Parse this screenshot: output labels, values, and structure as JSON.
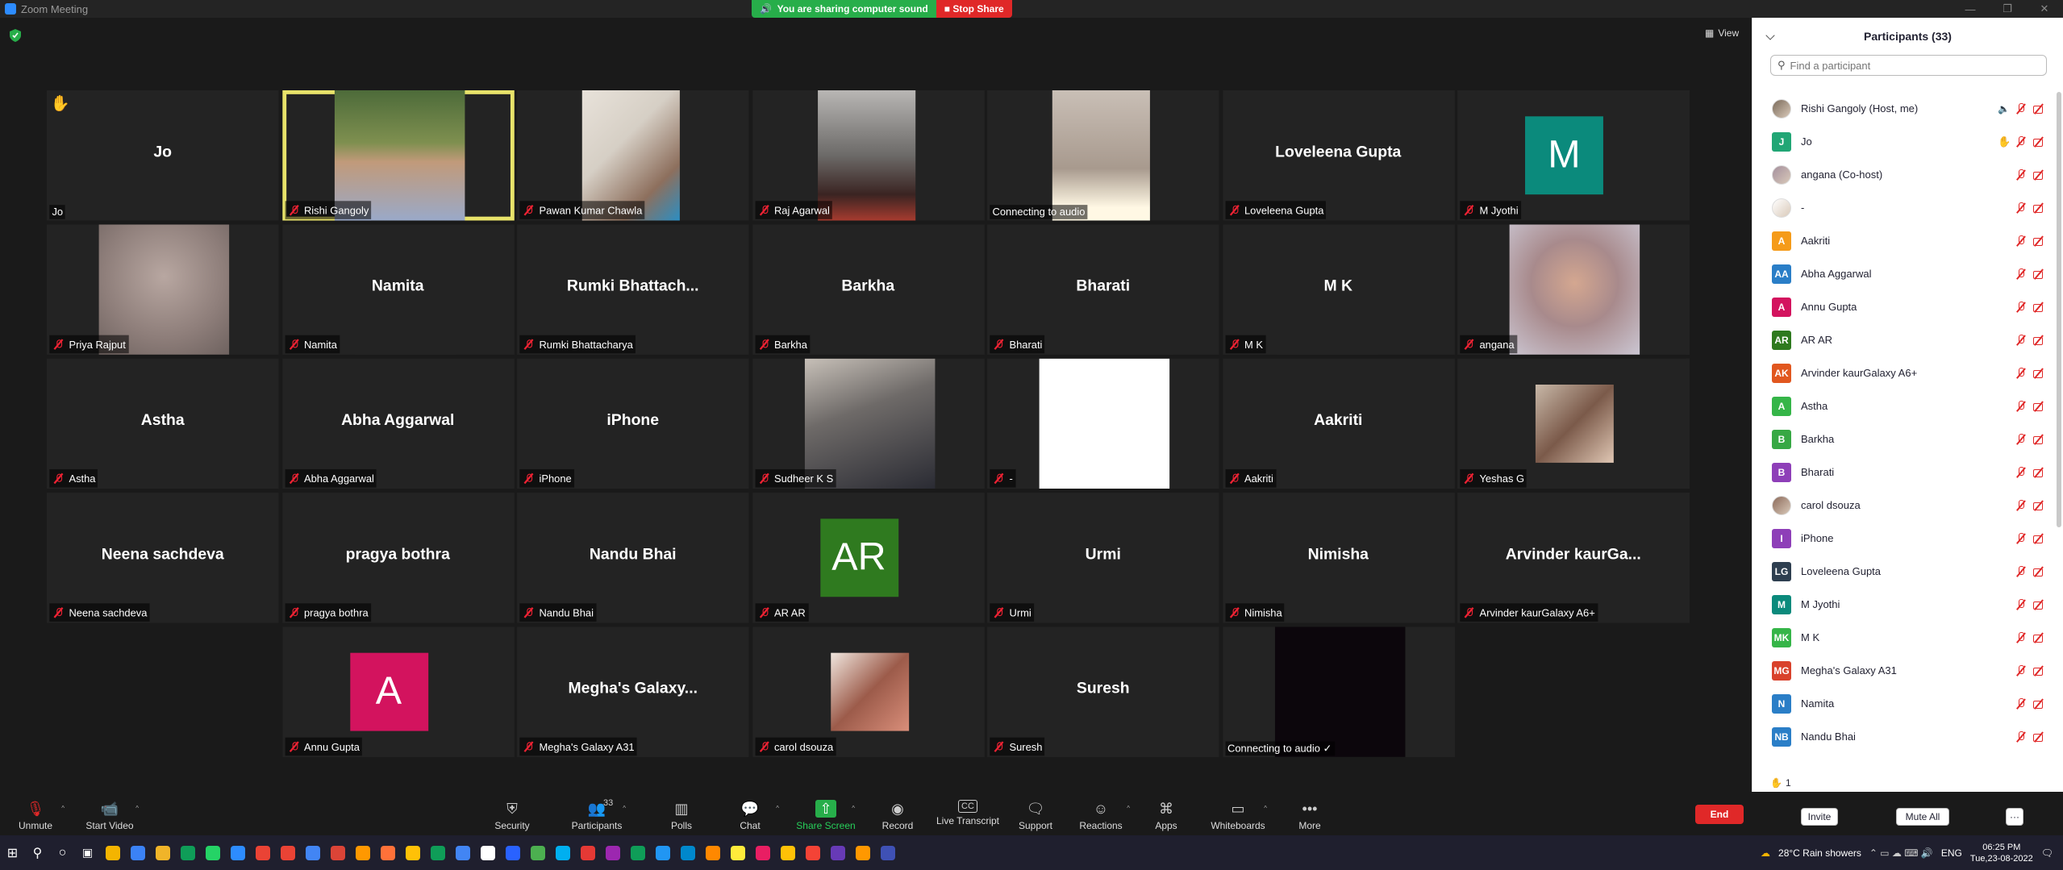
{
  "window": {
    "title": "Zoom Meeting"
  },
  "share_banner": {
    "sound_text": "You are sharing computer sound",
    "stop_label": "Stop Share"
  },
  "view_label": "View",
  "tiles": [
    {
      "big": "Jo",
      "label": "Jo",
      "muted": false,
      "hand": true
    },
    {
      "big": "",
      "label": "Rishi Gangoly",
      "muted": true,
      "photo": "rishi",
      "active": true
    },
    {
      "big": "",
      "label": "Pawan Kumar Chawla",
      "muted": true,
      "photo": "pawan"
    },
    {
      "big": "",
      "label": "Raj Agarwal",
      "muted": true,
      "photo": "raj"
    },
    {
      "big": "",
      "label": "Connecting to audio",
      "muted": false,
      "photo": "ceiling"
    },
    {
      "big": "Loveleena Gupta",
      "label": "Loveleena Gupta",
      "muted": true
    },
    {
      "big": "",
      "label": "M Jyothi",
      "muted": true,
      "avatar": "M",
      "avatar_color": "#0b8a7c"
    },
    {
      "big": "",
      "label": "Priya Rajput",
      "muted": true,
      "photo": "blur"
    },
    {
      "big": "Namita",
      "label": "Namita",
      "muted": true
    },
    {
      "big": "Rumki  Bhattach...",
      "label": "Rumki Bhattacharya",
      "muted": true
    },
    {
      "big": "Barkha",
      "label": "Barkha",
      "muted": true
    },
    {
      "big": "Bharati",
      "label": "Bharati",
      "muted": true
    },
    {
      "big": "M K",
      "label": "M K",
      "muted": true
    },
    {
      "big": "",
      "label": "angana",
      "muted": true,
      "photo": "angana"
    },
    {
      "big": "Astha",
      "label": "Astha",
      "muted": true
    },
    {
      "big": "Abha Aggarwal",
      "label": "Abha Aggarwal",
      "muted": true
    },
    {
      "big": "iPhone",
      "label": "iPhone",
      "muted": true
    },
    {
      "big": "",
      "label": "Sudheer K S",
      "muted": true,
      "photo": "sudheer"
    },
    {
      "big": "",
      "label": "-",
      "muted": true,
      "photo": "drawing"
    },
    {
      "big": "Aakriti",
      "label": "Aakriti",
      "muted": true
    },
    {
      "big": "",
      "label": "Yeshas G",
      "muted": true,
      "photo": "yeshas"
    },
    {
      "big": "Neena sachdeva",
      "label": "Neena sachdeva",
      "muted": true
    },
    {
      "big": "pragya bothra",
      "label": "pragya bothra",
      "muted": true
    },
    {
      "big": "Nandu Bhai",
      "label": "Nandu Bhai",
      "muted": true
    },
    {
      "big": "",
      "label": "AR AR",
      "muted": true,
      "avatar": "AR",
      "avatar_color": "#2f7a1f"
    },
    {
      "big": "Urmi",
      "label": "Urmi",
      "muted": true
    },
    {
      "big": "Nimisha",
      "label": "Nimisha",
      "muted": true
    },
    {
      "big": "Arvinder  kaurGa...",
      "label": "Arvinder kaurGalaxy A6+",
      "muted": true
    },
    {
      "big": "",
      "label": "Annu Gupta",
      "muted": true,
      "avatar": "A",
      "avatar_color": "#d3135e"
    },
    {
      "big": "Megha's  Galaxy...",
      "label": "Megha's Galaxy A31",
      "muted": true
    },
    {
      "big": "",
      "label": "carol dsouza",
      "muted": true,
      "photo": "carol"
    },
    {
      "big": "Suresh",
      "label": "Suresh",
      "muted": true
    },
    {
      "big": "",
      "label": "Connecting to audio ✓",
      "muted": false,
      "photo": "dark"
    }
  ],
  "participants_panel": {
    "title": "Participants (33)",
    "search_placeholder": "Find a participant",
    "participants": [
      {
        "name": "Rishi Gangoly (Host, me)",
        "initials": "",
        "color": "#7a6a5a",
        "photo": true,
        "speaking": true
      },
      {
        "name": "Jo",
        "initials": "J",
        "color": "#21a675",
        "hand": true
      },
      {
        "name": "angana (Co-host)",
        "initials": "",
        "color": "#a48f9d",
        "photo": true
      },
      {
        "name": "-",
        "initials": "",
        "color": "#ffffff",
        "photo": true
      },
      {
        "name": "Aakriti",
        "initials": "A",
        "color": "#f59b1a"
      },
      {
        "name": "Abha Aggarwal",
        "initials": "AA",
        "color": "#2a7ec7"
      },
      {
        "name": "Annu Gupta",
        "initials": "A",
        "color": "#d3135e"
      },
      {
        "name": "AR AR",
        "initials": "AR",
        "color": "#2f7a1f"
      },
      {
        "name": "Arvinder kaurGalaxy A6+",
        "initials": "AK",
        "color": "#e1571f"
      },
      {
        "name": "Astha",
        "initials": "A",
        "color": "#35b548"
      },
      {
        "name": "Barkha",
        "initials": "B",
        "color": "#37a844"
      },
      {
        "name": "Bharati",
        "initials": "B",
        "color": "#8e3fb8"
      },
      {
        "name": "carol dsouza",
        "initials": "",
        "color": "#8c6a5a",
        "photo": true
      },
      {
        "name": "iPhone",
        "initials": "I",
        "color": "#8e3fb8"
      },
      {
        "name": "Loveleena Gupta",
        "initials": "LG",
        "color": "#2e3f50"
      },
      {
        "name": "M Jyothi",
        "initials": "M",
        "color": "#0b8a7c"
      },
      {
        "name": "M K",
        "initials": "MK",
        "color": "#35b548"
      },
      {
        "name": "Megha's Galaxy A31",
        "initials": "MG",
        "color": "#d9422c"
      },
      {
        "name": "Namita",
        "initials": "N",
        "color": "#2a7ec7"
      },
      {
        "name": "Nandu Bhai",
        "initials": "NB",
        "color": "#2a7ec7"
      }
    ],
    "raised_count": "1",
    "invite_label": "Invite",
    "mute_all_label": "Mute All",
    "more_label": "···"
  },
  "toolbar": {
    "unmute": "Unmute",
    "start_video": "Start Video",
    "security": "Security",
    "participants": "Participants",
    "participants_count": "33",
    "polls": "Polls",
    "chat": "Chat",
    "share_screen": "Share Screen",
    "record": "Record",
    "live_transcript": "Live Transcript",
    "support": "Support",
    "reactions": "Reactions",
    "apps": "Apps",
    "whiteboards": "Whiteboards",
    "more": "More",
    "end": "End"
  },
  "taskbar": {
    "weather": "28°C  Rain showers",
    "lang": "ENG",
    "time": "06:25 PM",
    "date": "Tue,23-08-2022",
    "app_colors": [
      "#f4b400",
      "#3b82f6",
      "#f0b429",
      "#0f9d58",
      "#25d366",
      "#2d8cff",
      "#ea4335",
      "#ea4335",
      "#4285f4",
      "#db4437",
      "#ff9800",
      "#ff7139",
      "#ffc107",
      "#0f9d58",
      "#4285f4",
      "#ffffff",
      "#2962ff",
      "#4caf50",
      "#00aff0",
      "#e53935",
      "#9c27b0",
      "#0f9d58",
      "#2196f3",
      "#0088cc",
      "#ff8800",
      "#ffeb3b",
      "#e91e63",
      "#ffc107",
      "#f44336",
      "#673ab7",
      "#ff9800",
      "#3f51b5"
    ]
  }
}
